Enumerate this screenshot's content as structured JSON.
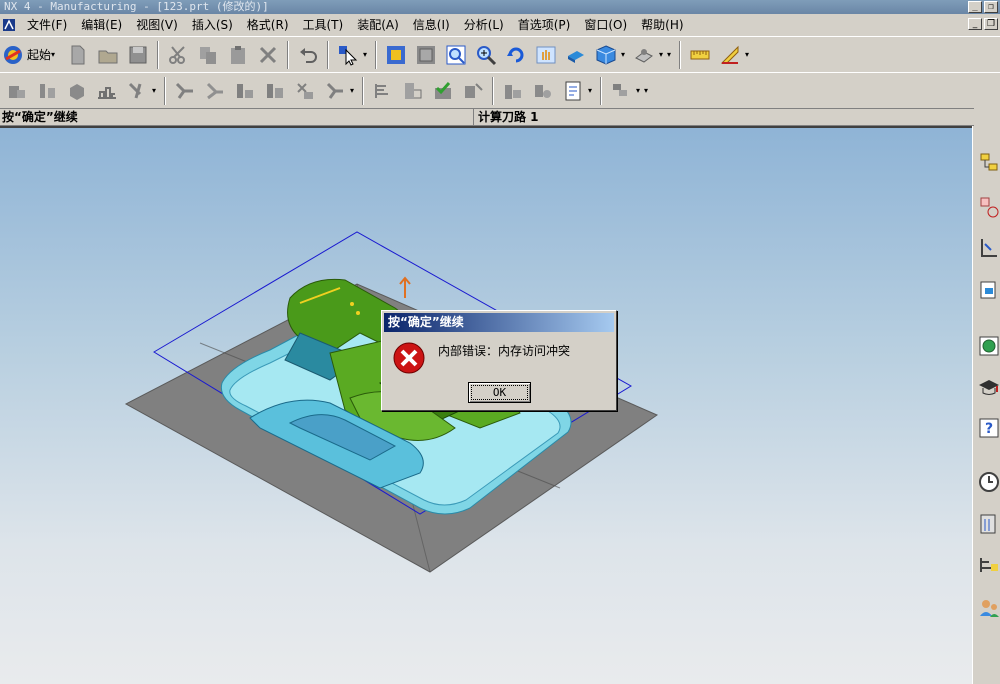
{
  "window": {
    "title": "NX 4 - Manufacturing - [123.prt (修改的)]"
  },
  "menubar": {
    "items": [
      "文件(F)",
      "编辑(E)",
      "视图(V)",
      "插入(S)",
      "格式(R)",
      "工具(T)",
      "装配(A)",
      "信息(I)",
      "分析(L)",
      "首选项(P)",
      "窗口(O)",
      "帮助(H)"
    ]
  },
  "toolbar": {
    "start_label": "起始"
  },
  "status": {
    "prompt": "按“确定”继续",
    "message": "计算刀路 1"
  },
  "dialog": {
    "title": "按“确定”继续",
    "message": "内部错误：内存访问冲突",
    "ok_label": "OK",
    "icon": "error-icon"
  },
  "colors": {
    "viewport_top": "#8fb4d6",
    "viewport_bottom": "#e9ebed",
    "plane": "#808080",
    "part_green": "#4a9a1a",
    "part_cyan": "#7fd6e6",
    "boundary_blue": "#1a1ad0",
    "dialog_title": "#0a246a",
    "error_red": "#cc1414"
  }
}
